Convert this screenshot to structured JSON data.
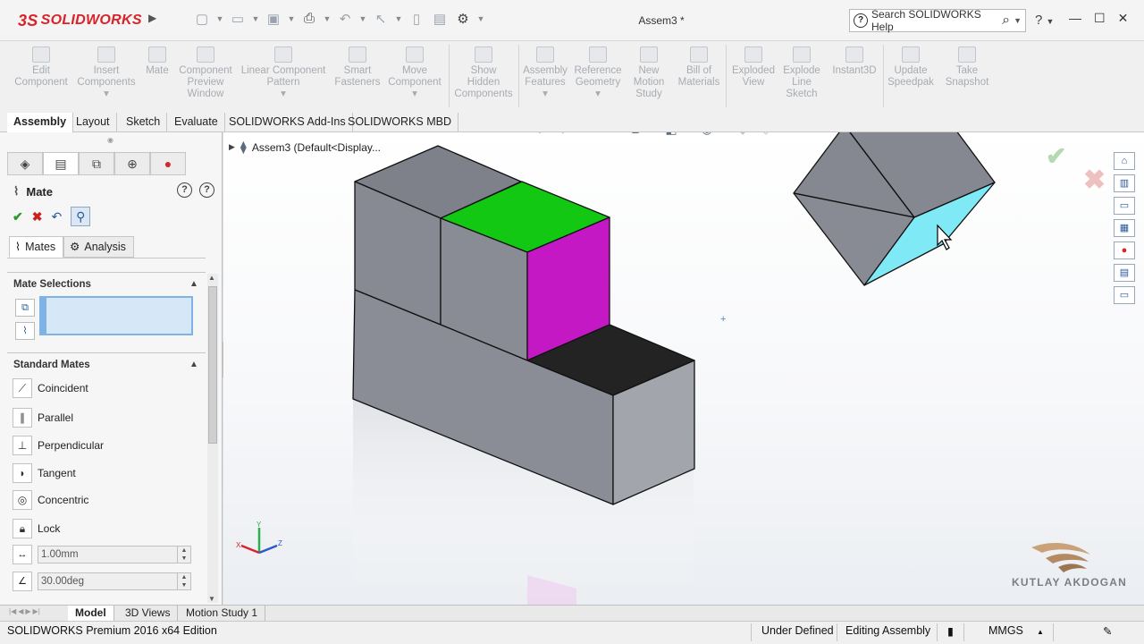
{
  "app": {
    "logo_prefix": "3S",
    "logo_text": "SOLIDWORKS",
    "document_title": "Assem3 *",
    "search_placeholder": "Search SOLIDWORKS Help"
  },
  "commands": [
    {
      "label": "Edit Component",
      "lines": [
        "Edit",
        "Component"
      ]
    },
    {
      "label": "Insert Components",
      "lines": [
        "Insert",
        "Components"
      ]
    },
    {
      "label": "Mate",
      "lines": [
        "Mate"
      ]
    },
    {
      "label": "Component Preview Window",
      "lines": [
        "Component",
        "Preview",
        "Window"
      ]
    },
    {
      "label": "Linear Component Pattern",
      "lines": [
        "Linear Component",
        "Pattern"
      ]
    },
    {
      "label": "Smart Fasteners",
      "lines": [
        "Smart",
        "Fasteners"
      ]
    },
    {
      "label": "Move Component",
      "lines": [
        "Move",
        "Component"
      ]
    },
    {
      "label": "Show Hidden Components",
      "lines": [
        "Show",
        "Hidden",
        "Components"
      ]
    },
    {
      "label": "Assembly Features",
      "lines": [
        "Assembly",
        "Features"
      ]
    },
    {
      "label": "Reference Geometry",
      "lines": [
        "Reference",
        "Geometry"
      ]
    },
    {
      "label": "New Motion Study",
      "lines": [
        "New",
        "Motion",
        "Study"
      ]
    },
    {
      "label": "Bill of Materials",
      "lines": [
        "Bill of",
        "Materials"
      ]
    },
    {
      "label": "Exploded View",
      "lines": [
        "Exploded",
        "View"
      ]
    },
    {
      "label": "Explode Line Sketch",
      "lines": [
        "Explode",
        "Line",
        "Sketch"
      ]
    },
    {
      "label": "Instant3D",
      "lines": [
        "Instant3D"
      ]
    },
    {
      "label": "Update Speedpak",
      "lines": [
        "Update",
        "Speedpak"
      ]
    },
    {
      "label": "Take Snapshot",
      "lines": [
        "Take",
        "Snapshot"
      ]
    }
  ],
  "tabs": [
    "Assembly",
    "Layout",
    "Sketch",
    "Evaluate",
    "SOLIDWORKS Add-Ins",
    "SOLIDWORKS MBD"
  ],
  "feature_tree": {
    "root_label": "Assem3  (Default<Display..."
  },
  "mate_panel": {
    "title": "Mate",
    "subtabs": [
      "Mates",
      "Analysis"
    ],
    "mate_selections_header": "Mate Selections",
    "standard_mates_header": "Standard Mates",
    "standard_mates": [
      "Coincident",
      "Parallel",
      "Perpendicular",
      "Tangent",
      "Concentric",
      "Lock"
    ],
    "distance_value": "1.00mm",
    "angle_value": "30.00deg"
  },
  "bottom_tabs": [
    "Model",
    "3D Views",
    "Motion Study 1"
  ],
  "status": {
    "edition": "SOLIDWORKS Premium 2016 x64 Edition",
    "definition": "Under Defined",
    "mode": "Editing Assembly",
    "units": "MMGS"
  },
  "watermark": {
    "name": "KUTLAY AKDOGAN"
  },
  "colors": {
    "brand_red": "#d8232a",
    "face_green": "#12c812",
    "face_magenta": "#c418c4",
    "face_black": "#232323",
    "face_cyan": "#7fe9f5",
    "body_grey": "#8c8f96"
  }
}
